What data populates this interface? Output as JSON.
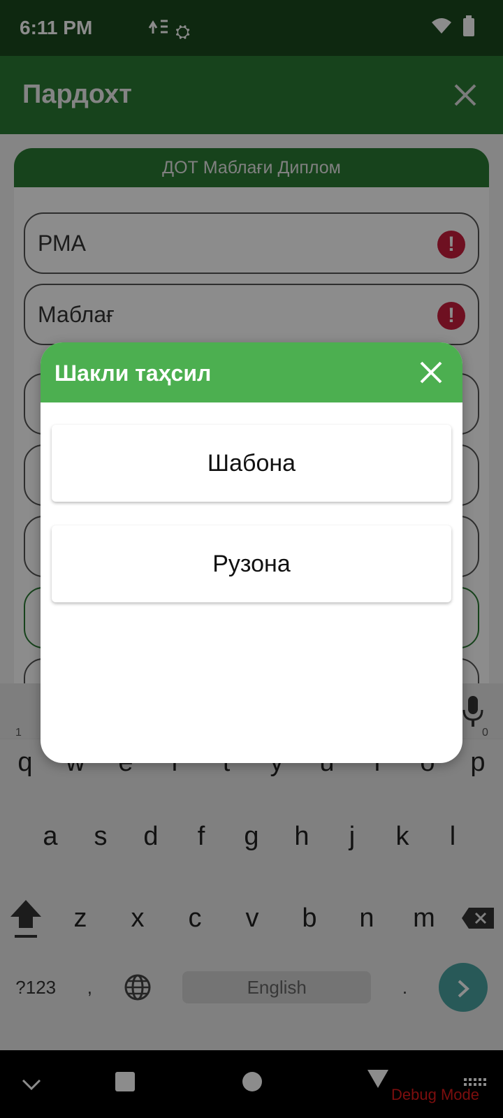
{
  "status_bar": {
    "time": "6:11 PM",
    "notif_icons": "⛭"
  },
  "app_bar": {
    "title": "Пардохт"
  },
  "form": {
    "card_title": "ДОТ Маблағи Диплом",
    "fields": [
      {
        "label": "РМА",
        "error": "!"
      },
      {
        "label": "Маблағ",
        "error": "!"
      }
    ]
  },
  "dialog": {
    "title": "Шакли таҳсил",
    "options": [
      {
        "label": "Шабона"
      },
      {
        "label": "Рузона"
      }
    ]
  },
  "keyboard": {
    "row1": [
      "q",
      "w",
      "e",
      "r",
      "t",
      "y",
      "u",
      "i",
      "o",
      "p"
    ],
    "row1_hints": [
      "1",
      "",
      "",
      "",
      "",
      "",
      "",
      "",
      "",
      "0"
    ],
    "row2": [
      "a",
      "s",
      "d",
      "f",
      "g",
      "h",
      "j",
      "k",
      "l"
    ],
    "row3": [
      "z",
      "x",
      "c",
      "v",
      "b",
      "n",
      "m"
    ],
    "symbols": "?123",
    "comma": ",",
    "space": "English",
    "period": "."
  },
  "nav": {
    "debug_label": "Debug Mode"
  },
  "colors": {
    "status": "#1b4a1e",
    "appbar": "#2b7a33",
    "dialog_header": "#4caf50",
    "error": "#c81e3c",
    "enter": "#4aa3a1"
  }
}
